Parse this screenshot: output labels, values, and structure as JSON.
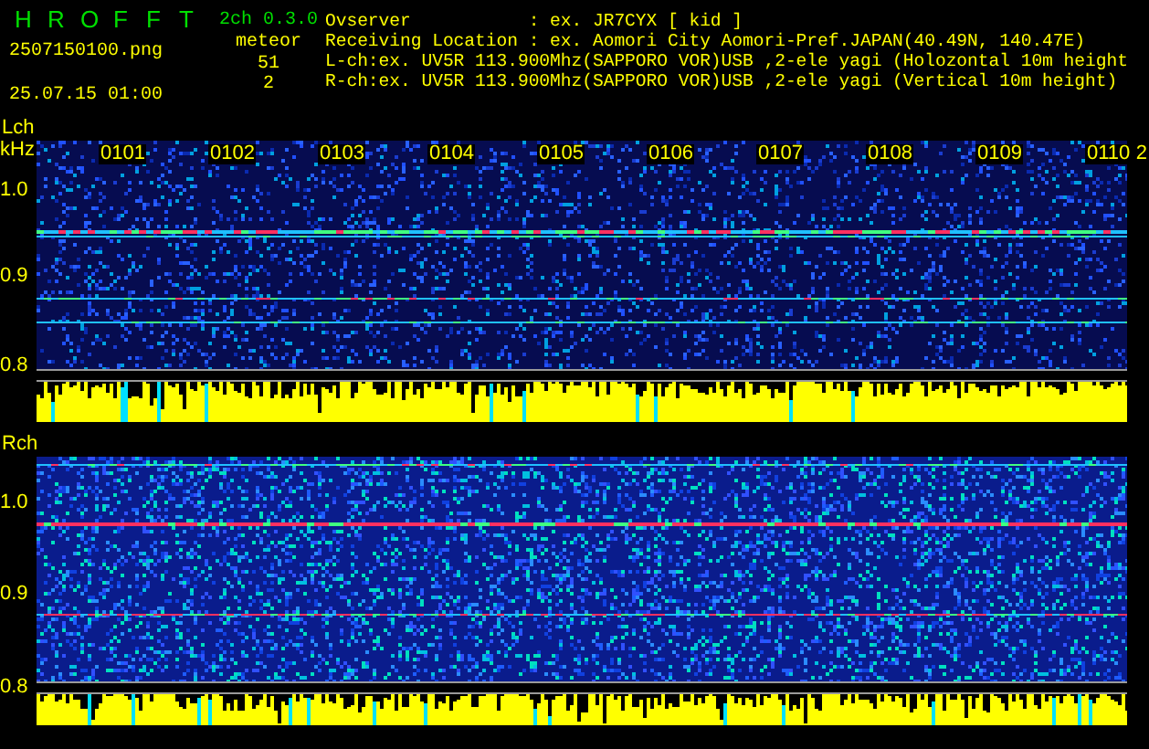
{
  "header": {
    "title_letters": [
      "H",
      "R",
      "O",
      "F",
      "F",
      "T"
    ],
    "version": "2ch 0.3.0",
    "file_name": "2507150100.png",
    "datetime": "25.07.15 01:00",
    "meteor_label": "meteor",
    "meteor_counts": [
      "51",
      "2"
    ],
    "info_lines": [
      "Ovserver           : ex. JR7CYX [ kid ]",
      "Receiving Location : ex. Aomori City Aomori-Pref.JAPAN(40.49N, 140.47E)",
      "L-ch:ex. UV5R 113.900Mhz(SAPPORO VOR)USB ,2-ele yagi (Holozontal 10m height",
      "R-ch:ex. UV5R 113.900Mhz(SAPPORO VOR)USB ,2-ele yagi (Vertical 10m height)"
    ]
  },
  "panels": [
    {
      "channel": "Lch",
      "unit": "kHz",
      "y_ticks": [
        "1.0",
        "0.9",
        "0.8"
      ],
      "time_labels": [
        "0101",
        "0102",
        "0103",
        "0104",
        "0105",
        "0106",
        "0107",
        "0108",
        "0109",
        "0110"
      ],
      "next_label": "2"
    },
    {
      "channel": "Rch",
      "y_ticks": [
        "1.0",
        "0.9",
        "0.8"
      ]
    }
  ]
}
